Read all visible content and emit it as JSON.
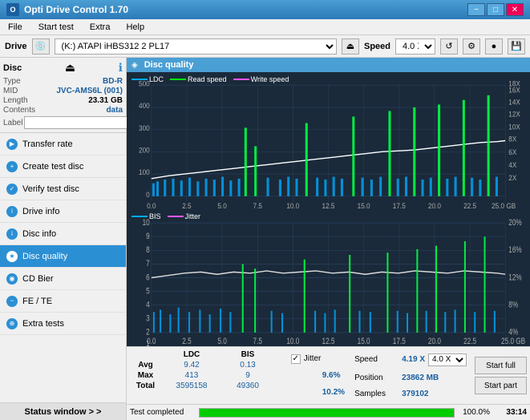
{
  "app": {
    "title": "Opti Drive Control 1.70",
    "icon": "O"
  },
  "title_controls": {
    "minimize": "−",
    "maximize": "□",
    "close": "✕"
  },
  "menu": {
    "items": [
      "File",
      "Start test",
      "Extra",
      "Help"
    ]
  },
  "drive_bar": {
    "label": "Drive",
    "drive_value": "(K:)  ATAPI iHBS312  2 PL17",
    "speed_label": "Speed",
    "speed_value": "4.0 X"
  },
  "disc": {
    "title": "Disc",
    "type_label": "Type",
    "type_value": "BD-R",
    "mid_label": "MID",
    "mid_value": "JVC-AMS6L (001)",
    "length_label": "Length",
    "length_value": "23.31 GB",
    "contents_label": "Contents",
    "contents_value": "data",
    "label_label": "Label",
    "label_value": ""
  },
  "nav": {
    "items": [
      {
        "id": "transfer-rate",
        "label": "Transfer rate",
        "active": false
      },
      {
        "id": "create-test-disc",
        "label": "Create test disc",
        "active": false
      },
      {
        "id": "verify-test-disc",
        "label": "Verify test disc",
        "active": false
      },
      {
        "id": "drive-info",
        "label": "Drive info",
        "active": false
      },
      {
        "id": "disc-info",
        "label": "Disc info",
        "active": false
      },
      {
        "id": "disc-quality",
        "label": "Disc quality",
        "active": true
      },
      {
        "id": "cd-bier",
        "label": "CD Bier",
        "active": false
      },
      {
        "id": "fe-te",
        "label": "FE / TE",
        "active": false
      },
      {
        "id": "extra-tests",
        "label": "Extra tests",
        "active": false
      }
    ]
  },
  "status_window": {
    "label": "Status window > >"
  },
  "chart": {
    "title": "Disc quality",
    "top_legend": {
      "ldc": "LDC",
      "read": "Read speed",
      "write": "Write speed"
    },
    "bottom_legend": {
      "bis": "BIS",
      "jitter": "Jitter"
    },
    "top_y_left": [
      "500",
      "400",
      "300",
      "200",
      "100",
      "0"
    ],
    "top_y_right": [
      "18X",
      "16X",
      "14X",
      "12X",
      "10X",
      "8X",
      "6X",
      "4X",
      "2X"
    ],
    "bottom_y_left": [
      "10",
      "9",
      "8",
      "7",
      "6",
      "5",
      "4",
      "3",
      "2",
      "1"
    ],
    "bottom_y_right": [
      "20%",
      "16%",
      "12%",
      "8%",
      "4%"
    ],
    "x_labels": [
      "0.0",
      "2.5",
      "5.0",
      "7.5",
      "10.0",
      "12.5",
      "15.0",
      "17.5",
      "20.0",
      "22.5",
      "25.0 GB"
    ]
  },
  "stats": {
    "headers": [
      "",
      "LDC",
      "BIS"
    ],
    "rows": [
      {
        "label": "Avg",
        "ldc": "9.42",
        "bis": "0.13"
      },
      {
        "label": "Max",
        "ldc": "413",
        "bis": "9"
      },
      {
        "label": "Total",
        "ldc": "3595158",
        "bis": "49360"
      }
    ],
    "jitter_label": "Jitter",
    "jitter_avg": "9.6%",
    "jitter_max": "10.2%",
    "jitter_blank": "",
    "speed_label": "Speed",
    "speed_value": "4.19 X",
    "speed_select": "4.0 X",
    "position_label": "Position",
    "position_value": "23862 MB",
    "samples_label": "Samples",
    "samples_value": "379102"
  },
  "buttons": {
    "start_full": "Start full",
    "start_part": "Start part"
  },
  "bottom_bar": {
    "status": "Test completed",
    "progress": 100,
    "progress_text": "100.0%",
    "time": "33:14"
  }
}
